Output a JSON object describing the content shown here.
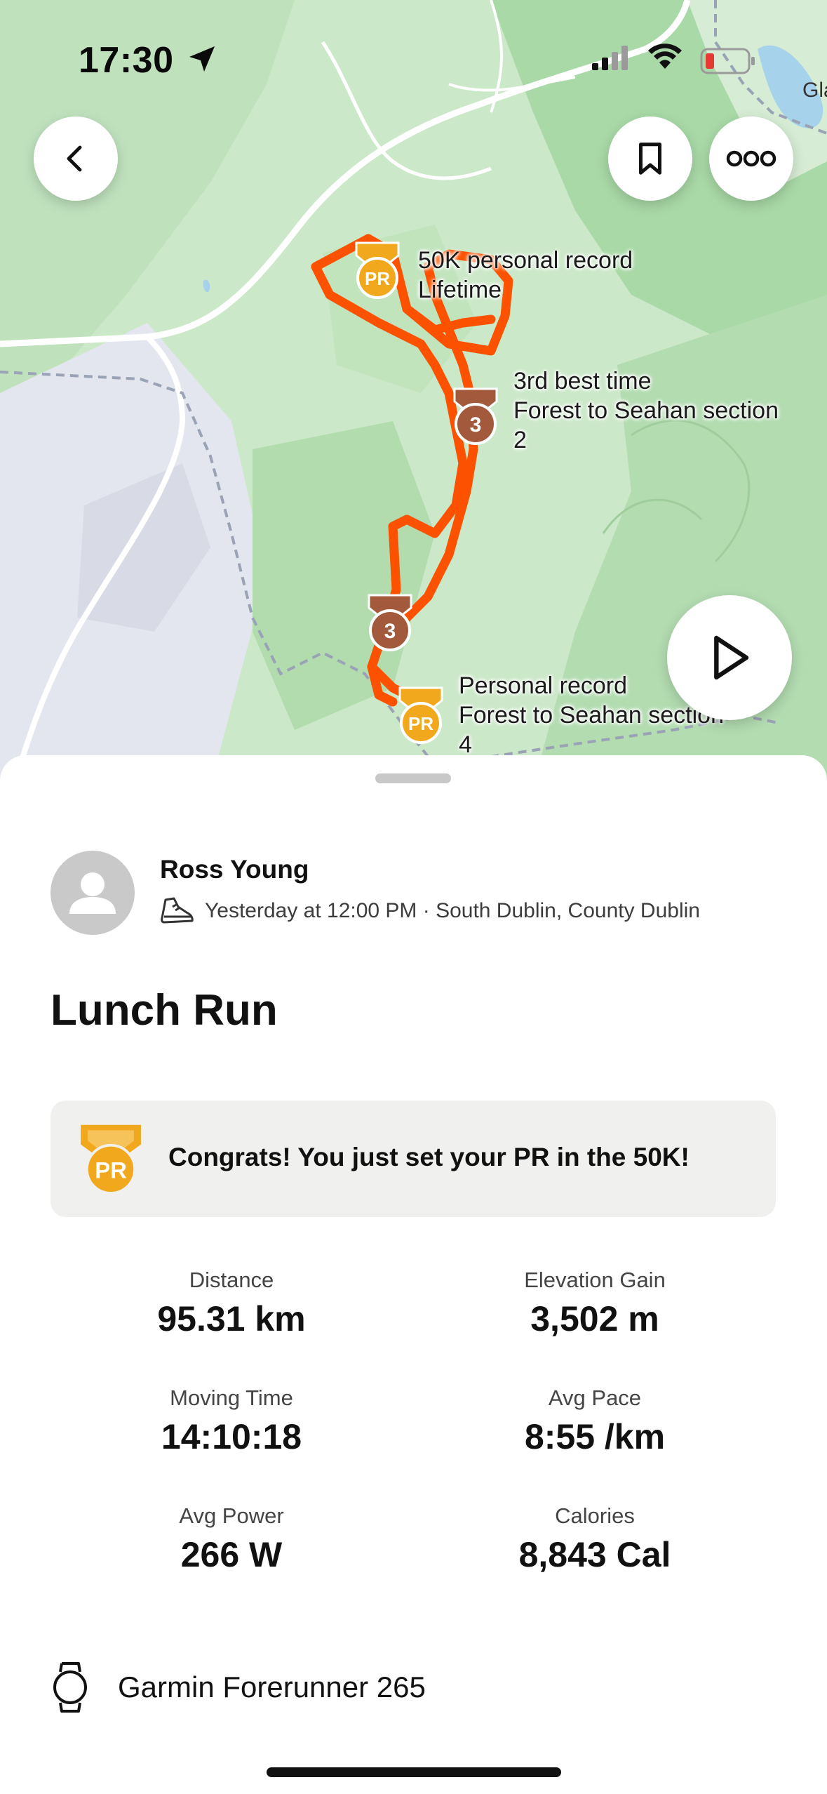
{
  "status_bar": {
    "time": "17:30"
  },
  "map": {
    "place_fragment": "Gla",
    "achievements": [
      {
        "icon": "pr-medal-icon",
        "badge_text": "PR",
        "line1": "50K personal record",
        "line2": "Lifetime"
      },
      {
        "icon": "bronze-medal-icon",
        "badge_text": "3",
        "line1": "3rd best time",
        "line2": "Forest to Seahan section",
        "line3": "2"
      },
      {
        "icon": "bronze-medal-icon",
        "badge_text": "3"
      },
      {
        "icon": "pr-medal-icon",
        "badge_text": "PR",
        "line1": "Personal record",
        "line2": "Forest to Seahan section",
        "line3": "4"
      }
    ],
    "colors": {
      "route": "#fc5200",
      "pr_gold": "#f2a81d",
      "bronze": "#a35a3c"
    }
  },
  "header_buttons": {
    "back": "chevron-left-icon",
    "save": "bookmark-icon",
    "more": "more-horizontal-icon",
    "play": "play-icon"
  },
  "activity": {
    "athlete": "Ross Young",
    "meta": "Yesterday at 12:00 PM · South Dublin, County Dublin",
    "title": "Lunch Run",
    "congrats": "Congrats! You just set your PR in the 50K!",
    "congrats_badge": "PR",
    "stats": [
      {
        "label": "Distance",
        "value": "95.31 km"
      },
      {
        "label": "Elevation Gain",
        "value": "3,502 m"
      },
      {
        "label": "Moving Time",
        "value": "14:10:18"
      },
      {
        "label": "Avg Pace",
        "value": "8:55 /km"
      },
      {
        "label": "Avg Power",
        "value": "266 W"
      },
      {
        "label": "Calories",
        "value": "8,843 Cal"
      }
    ],
    "device": "Garmin Forerunner 265"
  }
}
